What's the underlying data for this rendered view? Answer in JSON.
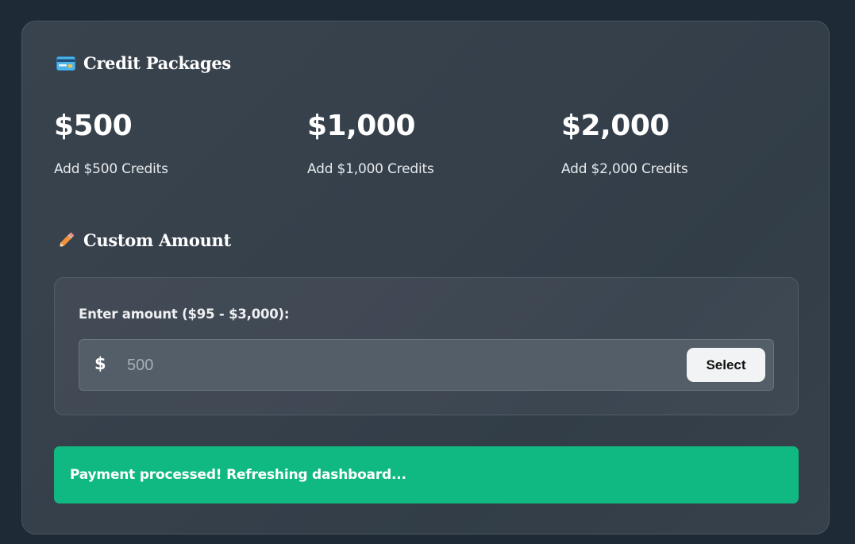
{
  "packages_section": {
    "icon": "credit-card-icon",
    "title": "Credit Packages",
    "items": [
      {
        "price": "$500",
        "description": "Add $500 Credits"
      },
      {
        "price": "$1,000",
        "description": "Add $1,000 Credits"
      },
      {
        "price": "$2,000",
        "description": "Add $2,000 Credits"
      }
    ]
  },
  "custom_section": {
    "icon": "pencil-icon",
    "title": "Custom Amount",
    "label": "Enter amount ($95 - $3,000):",
    "currency_symbol": "$",
    "input_value": "",
    "input_placeholder": "500",
    "select_label": "Select"
  },
  "status_message": {
    "text": "Payment processed! Refreshing dashboard...",
    "color": "#10b981"
  }
}
